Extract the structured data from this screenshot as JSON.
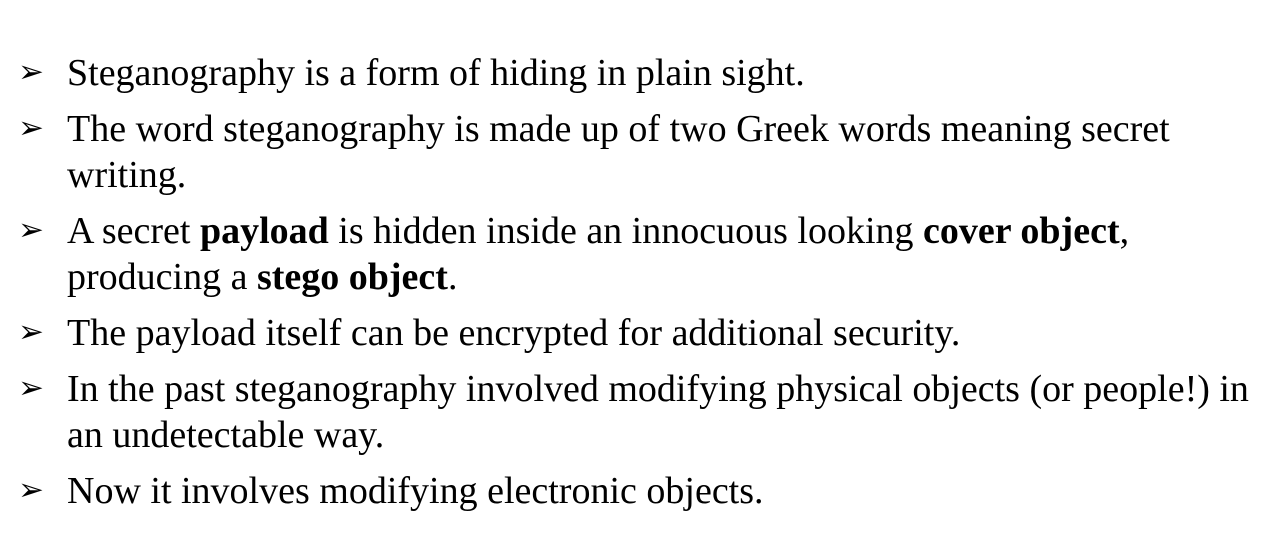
{
  "bullet_icon": "arrowhead-bullet-icon",
  "marker": "➢",
  "bullets": [
    {
      "segments": [
        "Steganography is a form of hiding in plain sight."
      ]
    },
    {
      "segments": [
        "The word steganography is made up of two Greek words meaning secret writing."
      ]
    },
    {
      "segments": [
        "A secret ",
        "payload",
        " is hidden inside an innocuous looking ",
        "cover object",
        ", producing a ",
        "stego object",
        "."
      ]
    },
    {
      "segments": [
        "The payload itself can be encrypted for additional security."
      ]
    },
    {
      "segments": [
        "In the past steganography involved modifying physical objects (or people!) in an undetectable way."
      ]
    },
    {
      "segments": [
        "Now it involves modifying electronic objects."
      ]
    }
  ]
}
